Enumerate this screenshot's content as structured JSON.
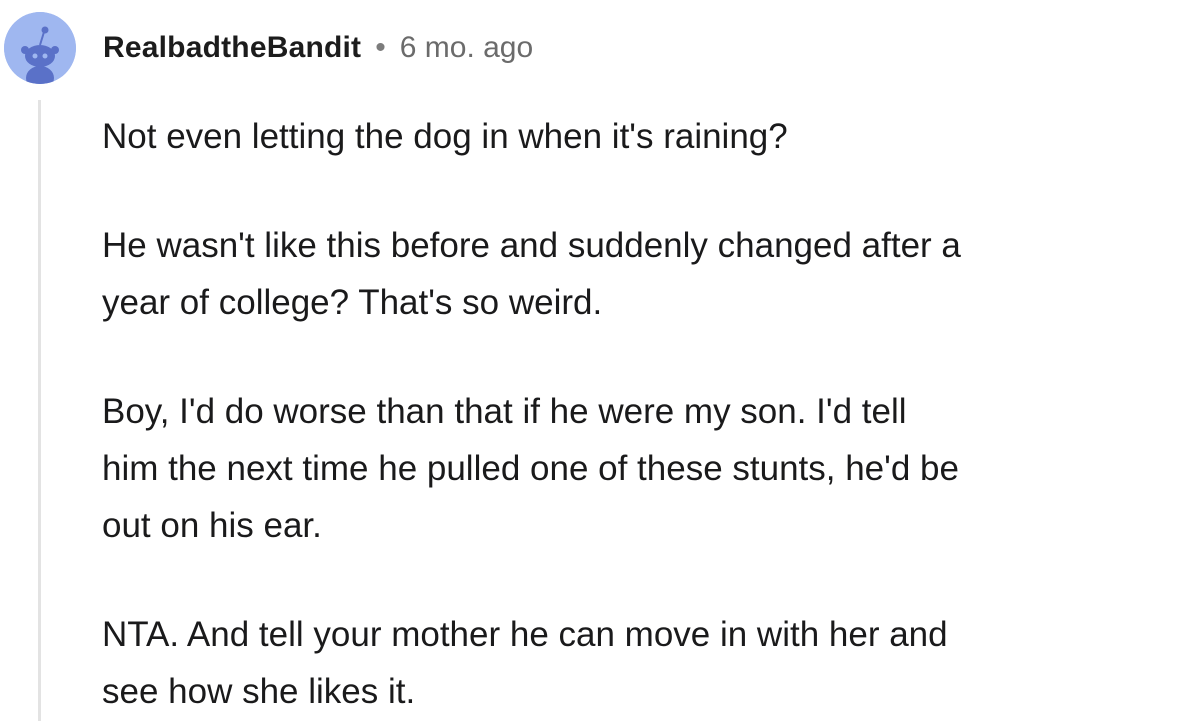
{
  "comment": {
    "username": "RealbadtheBandit",
    "separator": "•",
    "timestamp": "6 mo. ago",
    "avatar_icon": "snoo-avatar-icon",
    "paragraphs": [
      {
        "lines": [
          "Not even letting the dog in when it's raining?"
        ]
      },
      {
        "lines": [
          "He wasn't like this before and suddenly changed after a",
          "year of college? That's so weird."
        ]
      },
      {
        "lines": [
          "Boy, I'd do worse than that if he were my son. I'd tell",
          "him the next time he pulled one of these stunts, he'd be",
          "out on his ear."
        ]
      },
      {
        "lines": [
          "NTA. And tell your mother he can move in with her and",
          "see how she likes it."
        ]
      }
    ]
  },
  "colors": {
    "avatar_background": "#9fb7f0",
    "avatar_figure": "#5a71c8",
    "username_text": "#1c1c1c",
    "timestamp_text": "#6b6b6b",
    "body_text": "#1a1a1b",
    "thread_line": "#e3e3e3"
  }
}
